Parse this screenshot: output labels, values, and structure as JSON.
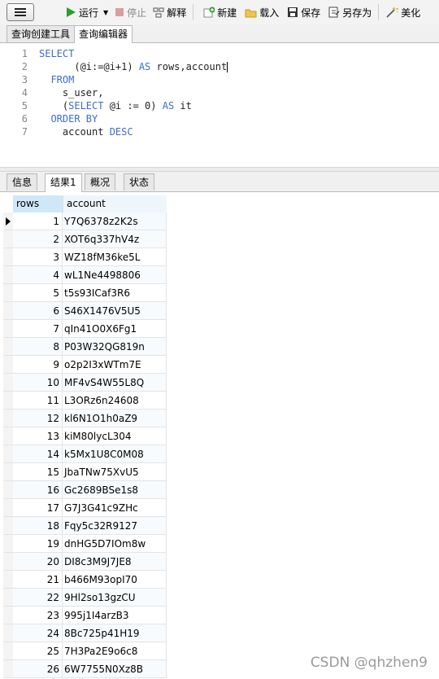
{
  "toolbar": {
    "run_label": "运行",
    "stop_label": "停止",
    "explain_label": "解释",
    "new_label": "新建",
    "load_label": "载入",
    "save_label": "保存",
    "saveas_label": "另存为",
    "beautify_label": "美化"
  },
  "editor_tabs": [
    "查询创建工具",
    "查询编辑器"
  ],
  "editor": {
    "line_numbers": [
      "1",
      "2",
      "3",
      "4",
      "5",
      "6",
      "7"
    ]
  },
  "result_tabs": [
    "信息",
    "结果1",
    "概况",
    "状态"
  ],
  "grid": {
    "columns": [
      "rows",
      "account"
    ],
    "rows": [
      {
        "rows": "1",
        "account": "Y7Q6378z2K2s"
      },
      {
        "rows": "2",
        "account": "XOT6q337hV4z"
      },
      {
        "rows": "3",
        "account": "WZ18fM36ke5L"
      },
      {
        "rows": "4",
        "account": "wL1Ne4498806"
      },
      {
        "rows": "5",
        "account": "t5s93ICaf3R6"
      },
      {
        "rows": "6",
        "account": "S46X1476V5U5"
      },
      {
        "rows": "7",
        "account": "qIn41O0X6Fg1"
      },
      {
        "rows": "8",
        "account": "P03W32QG819n"
      },
      {
        "rows": "9",
        "account": "o2p2I3xWTm7E"
      },
      {
        "rows": "10",
        "account": "MF4vS4W55L8Q"
      },
      {
        "rows": "11",
        "account": "L3ORz6n24608"
      },
      {
        "rows": "12",
        "account": "kl6N1O1h0aZ9"
      },
      {
        "rows": "13",
        "account": "kiM80lycL304"
      },
      {
        "rows": "14",
        "account": "k5Mx1U8C0M08"
      },
      {
        "rows": "15",
        "account": "JbaTNw75XvU5"
      },
      {
        "rows": "16",
        "account": "Gc2689BSe1s8"
      },
      {
        "rows": "17",
        "account": "G7J3G41c9ZHc"
      },
      {
        "rows": "18",
        "account": "Fqy5c32R9127"
      },
      {
        "rows": "19",
        "account": "dnHG5D7IOm8w"
      },
      {
        "rows": "20",
        "account": "DI8c3M9J7JE8"
      },
      {
        "rows": "21",
        "account": "b466M93opI70"
      },
      {
        "rows": "22",
        "account": "9Hl2so13gzCU"
      },
      {
        "rows": "23",
        "account": "995j1I4arzB3"
      },
      {
        "rows": "24",
        "account": "8Bc725p41H19"
      },
      {
        "rows": "25",
        "account": "7H3Pa2E9o6c8"
      },
      {
        "rows": "26",
        "account": "6W7755N0Xz8B"
      }
    ]
  },
  "watermark": "CSDN @qhzhen9"
}
